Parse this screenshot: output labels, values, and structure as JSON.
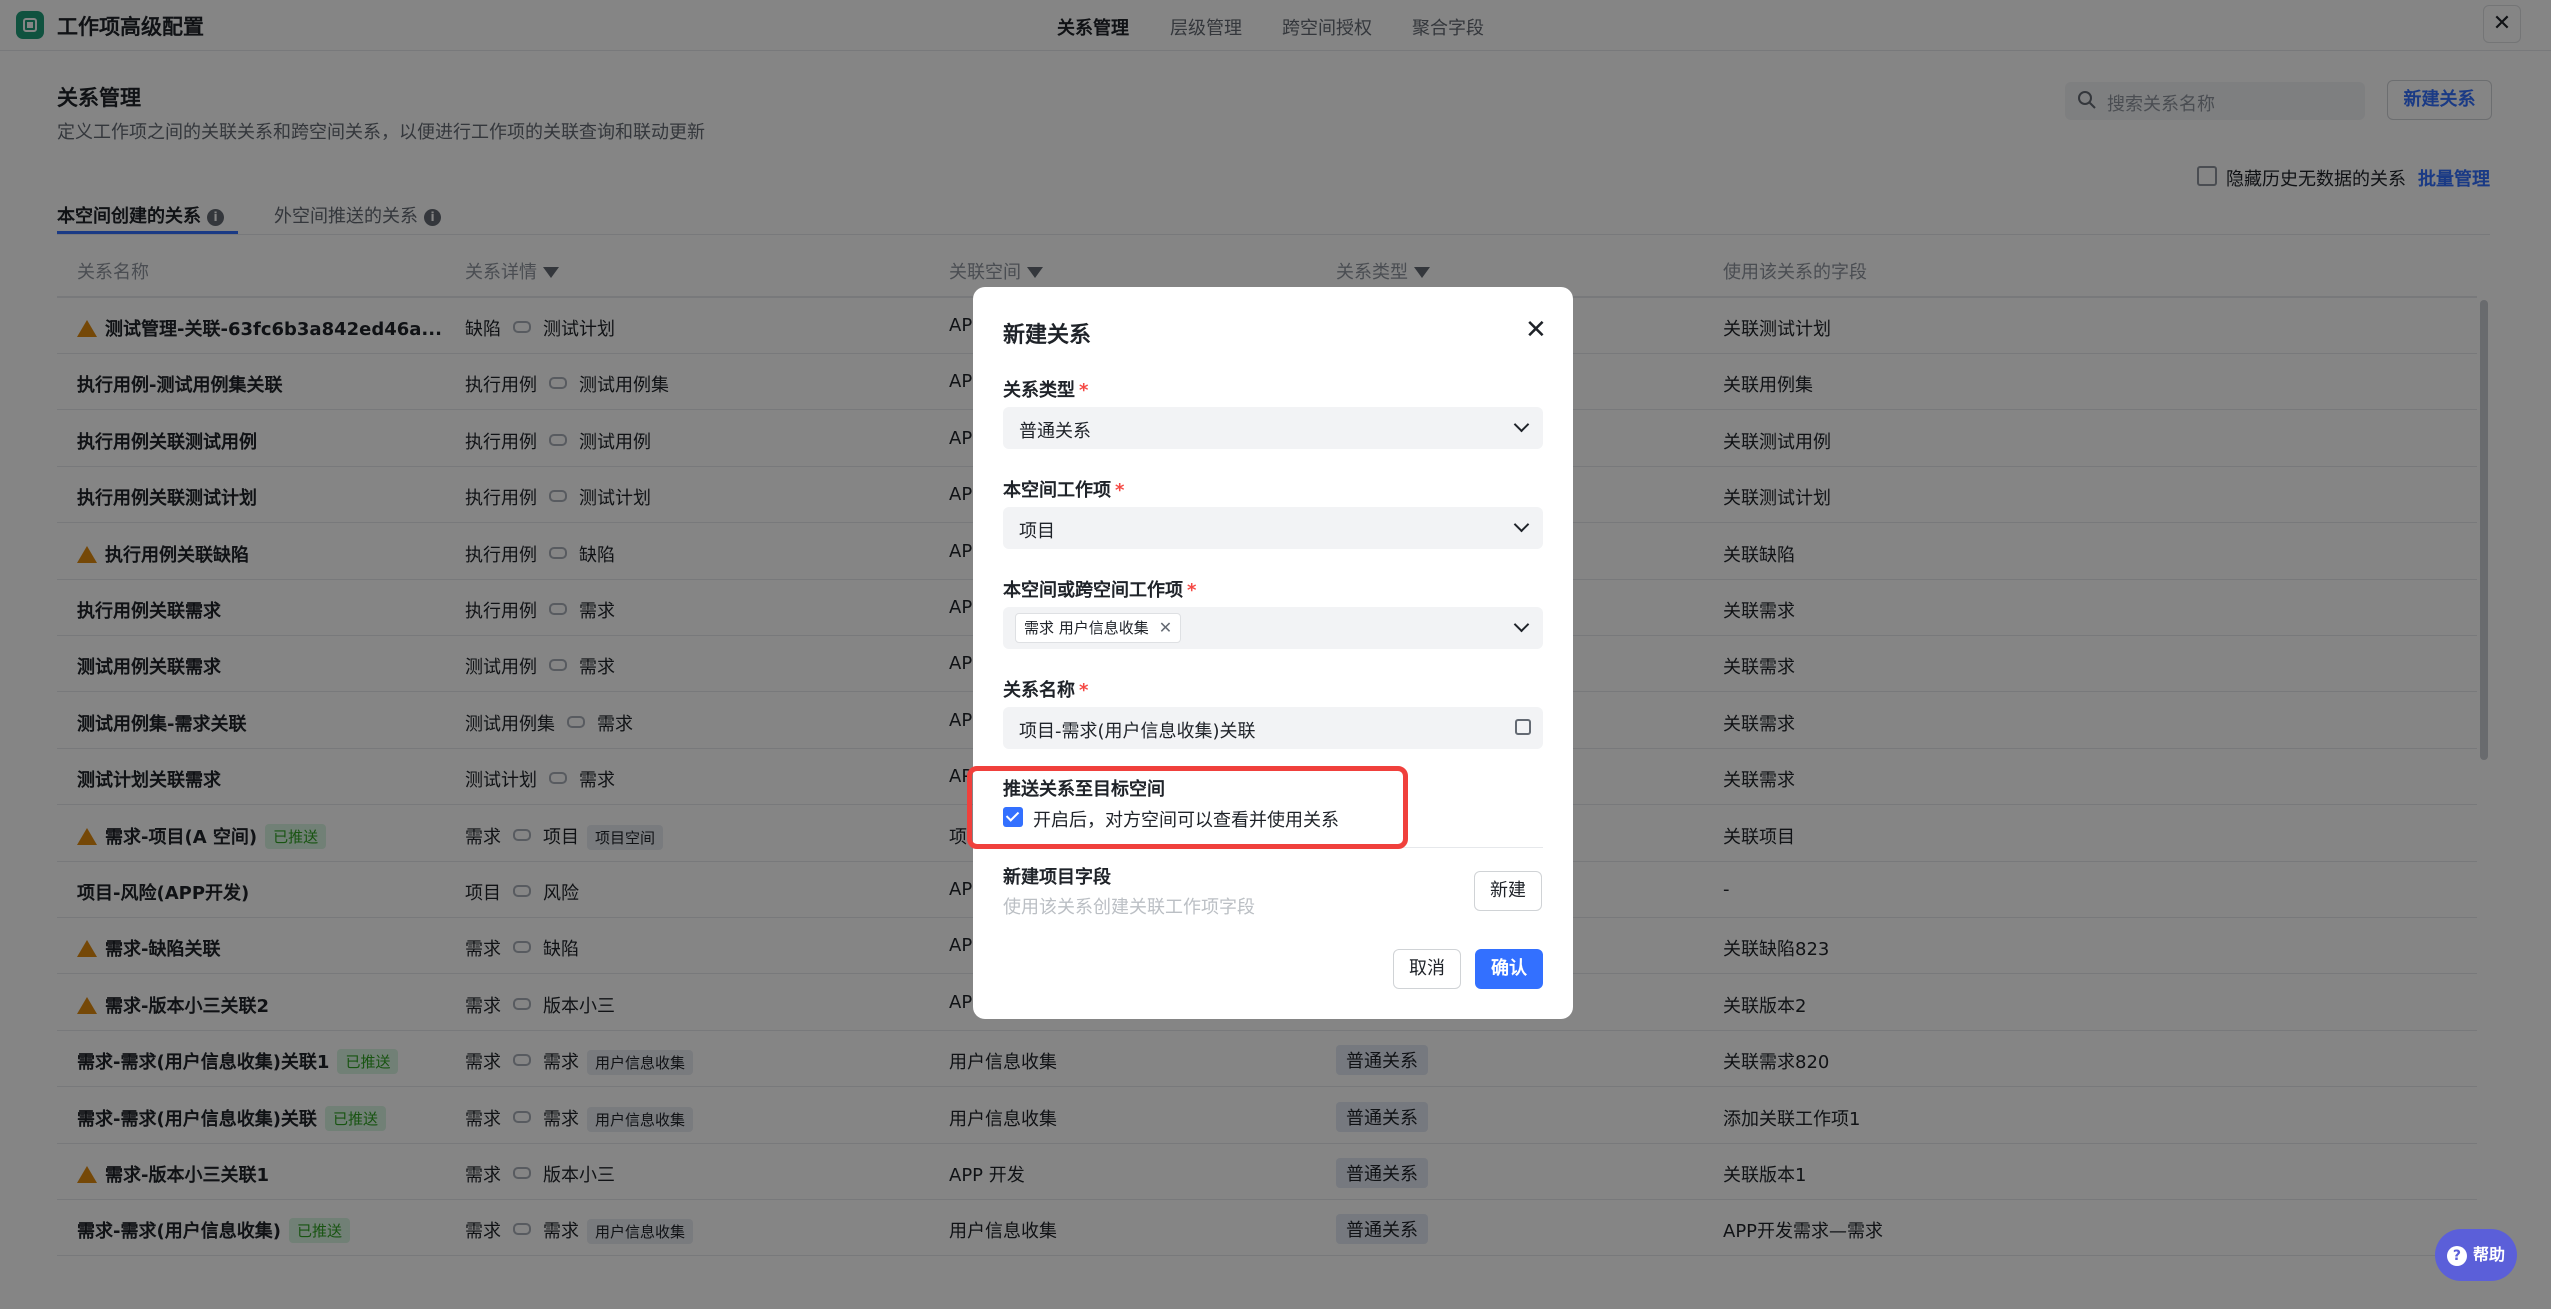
{
  "app": {
    "title": "工作项高级配置",
    "close": "✕"
  },
  "topnav": [
    "关系管理",
    "层级管理",
    "跨空间授权",
    "聚合字段"
  ],
  "header": {
    "title": "关系管理",
    "desc": "定义工作项之间的关联关系和跨空间关系，以便进行工作项的关联查询和联动更新"
  },
  "search": {
    "placeholder": "搜索关系名称"
  },
  "actions": {
    "new_relation": "新建关系",
    "hide_label": "隐藏历史无数据的关系",
    "batch": "批量管理"
  },
  "tabs": [
    "本空间创建的关系",
    "外空间推送的关系"
  ],
  "columns": [
    "关系名称",
    "关系详情",
    "关联空间",
    "关系类型",
    "使用该关系的字段"
  ],
  "rows": [
    {
      "name": "测试管理-关联-63fc6b3a842ed46a...",
      "warn": true,
      "pushed": "",
      "from": "缺陷",
      "to": "测试计划",
      "space_tag": "",
      "space": "AP",
      "type": "",
      "field": "关联测试计划"
    },
    {
      "name": "执行用例-测试用例集关联",
      "warn": false,
      "pushed": "",
      "from": "执行用例",
      "to": "测试用例集",
      "space_tag": "",
      "space": "AP",
      "type": "",
      "field": "关联用例集"
    },
    {
      "name": "执行用例关联测试用例",
      "warn": false,
      "pushed": "",
      "from": "执行用例",
      "to": "测试用例",
      "space_tag": "",
      "space": "AP",
      "type": "",
      "field": "关联测试用例"
    },
    {
      "name": "执行用例关联测试计划",
      "warn": false,
      "pushed": "",
      "from": "执行用例",
      "to": "测试计划",
      "space_tag": "",
      "space": "AP",
      "type": "",
      "field": "关联测试计划"
    },
    {
      "name": "执行用例关联缺陷",
      "warn": true,
      "pushed": "",
      "from": "执行用例",
      "to": "缺陷",
      "space_tag": "",
      "space": "AP",
      "type": "",
      "field": "关联缺陷"
    },
    {
      "name": "执行用例关联需求",
      "warn": false,
      "pushed": "",
      "from": "执行用例",
      "to": "需求",
      "space_tag": "",
      "space": "AP",
      "type": "",
      "field": "关联需求"
    },
    {
      "name": "测试用例关联需求",
      "warn": false,
      "pushed": "",
      "from": "测试用例",
      "to": "需求",
      "space_tag": "",
      "space": "AP",
      "type": "",
      "field": "关联需求"
    },
    {
      "name": "测试用例集-需求关联",
      "warn": false,
      "pushed": "",
      "from": "测试用例集",
      "to": "需求",
      "space_tag": "",
      "space": "AP",
      "type": "",
      "field": "关联需求"
    },
    {
      "name": "测试计划关联需求",
      "warn": false,
      "pushed": "",
      "from": "测试计划",
      "to": "需求",
      "space_tag": "",
      "space": "AP",
      "type": "",
      "field": "关联需求"
    },
    {
      "name": "需求-项目(A 空间)",
      "warn": true,
      "pushed": "已推送",
      "from": "需求",
      "to": "项目",
      "space_tag": "项目空间",
      "space": "项",
      "type": "",
      "field": "关联项目"
    },
    {
      "name": "项目-风险(APP开发)",
      "warn": false,
      "pushed": "",
      "from": "项目",
      "to": "风险",
      "space_tag": "",
      "space": "AP",
      "type": "",
      "field": "-"
    },
    {
      "name": "需求-缺陷关联",
      "warn": true,
      "pushed": "",
      "from": "需求",
      "to": "缺陷",
      "space_tag": "",
      "space": "AP",
      "type": "",
      "field": "关联缺陷823"
    },
    {
      "name": "需求-版本小三关联2",
      "warn": true,
      "pushed": "",
      "from": "需求",
      "to": "版本小三",
      "space_tag": "",
      "space": "AP",
      "type": "",
      "field": "关联版本2"
    },
    {
      "name": "需求-需求(用户信息收集)关联1",
      "warn": false,
      "pushed": "已推送",
      "from": "需求",
      "to": "需求",
      "space_tag": "用户信息收集",
      "space": "用户信息收集",
      "type": "普通关系",
      "field": "关联需求820"
    },
    {
      "name": "需求-需求(用户信息收集)关联",
      "warn": false,
      "pushed": "已推送",
      "from": "需求",
      "to": "需求",
      "space_tag": "用户信息收集",
      "space": "用户信息收集",
      "type": "普通关系",
      "field": "添加关联工作项1"
    },
    {
      "name": "需求-版本小三关联1",
      "warn": true,
      "pushed": "",
      "from": "需求",
      "to": "版本小三",
      "space_tag": "",
      "space": "APP 开发",
      "type": "普通关系",
      "field": "关联版本1"
    },
    {
      "name": "需求-需求(用户信息收集)",
      "warn": false,
      "pushed": "已推送",
      "from": "需求",
      "to": "需求",
      "space_tag": "用户信息收集",
      "space": "用户信息收集",
      "type": "普通关系",
      "field": "APP开发需求—需求"
    }
  ],
  "modal": {
    "title": "新建关系",
    "relation_type_label": "关系类型",
    "relation_type_value": "普通关系",
    "local_item_label": "本空间工作项",
    "local_item_value": "项目",
    "target_item_label": "本空间或跨空间工作项",
    "target_chip": "需求  用户信息收集",
    "name_label": "关系名称",
    "name_value": "项目-需求(用户信息收集)关联",
    "push_title": "推送关系至目标空间",
    "push_checkbox": "开启后，对方空间可以查看并使用关系",
    "push_checked": true,
    "new_field_title": "新建项目字段",
    "new_field_desc": "使用该关系创建关联工作项字段",
    "new_field_button": "新建",
    "cancel": "取消",
    "confirm": "确认"
  },
  "help": "帮助",
  "colors": {
    "accent": "#3370ff",
    "brand": "#1f9e7a",
    "warning": "#e08a0e",
    "highlight": "#f0403c"
  }
}
